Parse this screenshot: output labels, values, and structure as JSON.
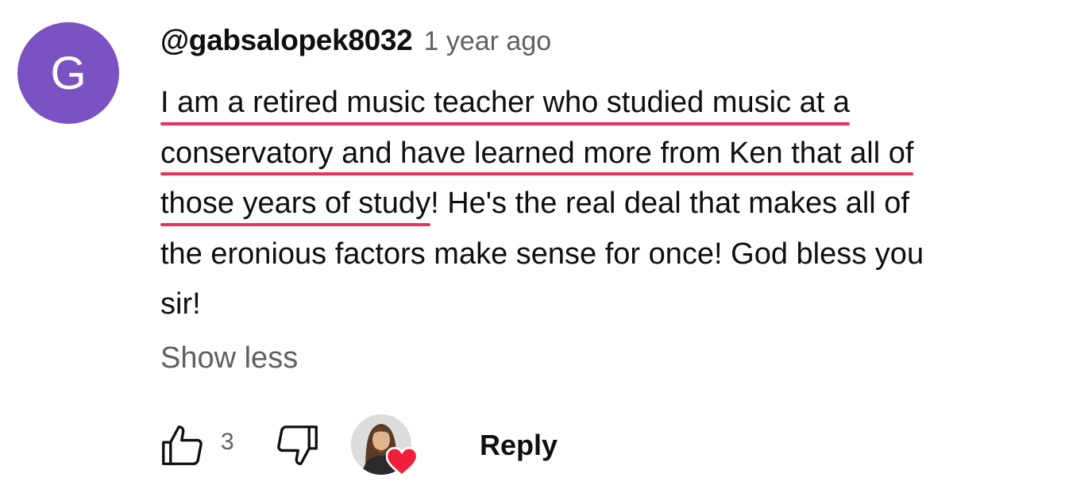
{
  "comment": {
    "avatar_letter": "G",
    "avatar_color": "#7b52c1",
    "author": "@gabsalopek8032",
    "timestamp": "1 year ago",
    "body_lines": [
      {
        "highlighted": "I am a retired music teacher who studied music at a",
        "rest": ""
      },
      {
        "highlighted": "conservatory and have learned more from Ken that all of",
        "rest": ""
      },
      {
        "highlighted": "those years of study",
        "rest": "! He's the real deal that makes all of"
      },
      {
        "highlighted": "",
        "rest": "the eronious factors make sense for once! God bless you"
      },
      {
        "highlighted": "",
        "rest": "sir!"
      }
    ],
    "highlight_color": "#e8345a",
    "show_less_label": "Show less"
  },
  "actions": {
    "like_icon": "thumbs-up-icon",
    "like_count": "3",
    "dislike_icon": "thumbs-down-icon",
    "creator_heart_icon": "heart-icon",
    "heart_color": "#f0203c",
    "reply_label": "Reply"
  }
}
